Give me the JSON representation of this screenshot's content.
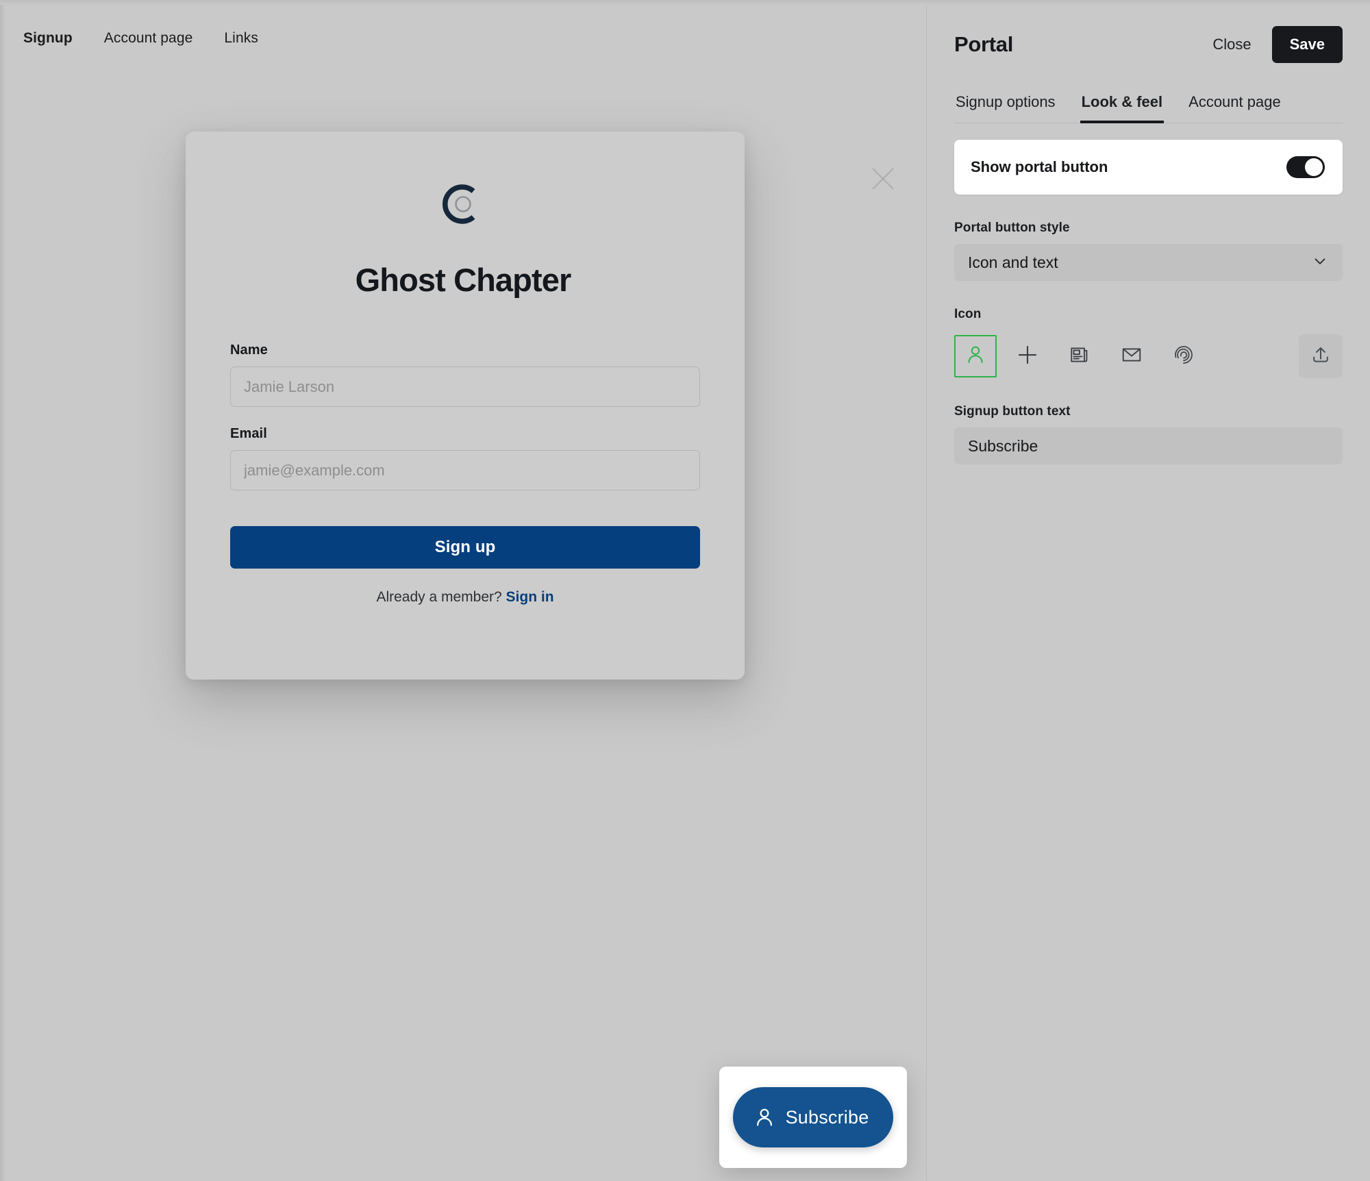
{
  "preview": {
    "tabs": [
      {
        "label": "Signup",
        "active": true
      },
      {
        "label": "Account page",
        "active": false
      },
      {
        "label": "Links",
        "active": false
      }
    ],
    "modal": {
      "close_icon": "close-icon",
      "logo_icon": "ghost-chapter-logo",
      "site_title": "Ghost Chapter",
      "fields": [
        {
          "label": "Name",
          "value": "",
          "placeholder": "Jamie Larson",
          "name": "name-field"
        },
        {
          "label": "Email",
          "value": "",
          "placeholder": "jamie@example.com",
          "name": "email-field"
        }
      ],
      "submit_label": "Sign up",
      "member_prompt": "Already a member?",
      "signin_label": "Sign in"
    },
    "portal_widget": {
      "icon": "user-icon",
      "label": "Subscribe"
    }
  },
  "settings": {
    "title": "Portal",
    "close_label": "Close",
    "save_label": "Save",
    "tabs": [
      {
        "label": "Signup options",
        "active": false
      },
      {
        "label": "Look & feel",
        "active": true
      },
      {
        "label": "Account page",
        "active": false
      }
    ],
    "show_portal_button": {
      "label": "Show portal button",
      "enabled": true
    },
    "portal_button_style": {
      "label": "Portal button style",
      "value": "Icon and text",
      "chevron": "chevron-down-icon"
    },
    "icon_section": {
      "label": "Icon",
      "options": [
        {
          "name": "user-icon",
          "selected": true
        },
        {
          "name": "plus-icon",
          "selected": false
        },
        {
          "name": "newspaper-icon",
          "selected": false
        },
        {
          "name": "envelope-icon",
          "selected": false
        },
        {
          "name": "fingerprint-icon",
          "selected": false
        }
      ],
      "upload": {
        "name": "upload-icon"
      }
    },
    "signup_button_text": {
      "label": "Signup button text",
      "value": "Subscribe",
      "placeholder": "Subscribe"
    }
  },
  "colors": {
    "background": "#c9c9c9",
    "accent_blue": "#063f7d",
    "widget_blue": "#14538f",
    "dark": "#17191c",
    "selected_green": "#2db34a"
  }
}
